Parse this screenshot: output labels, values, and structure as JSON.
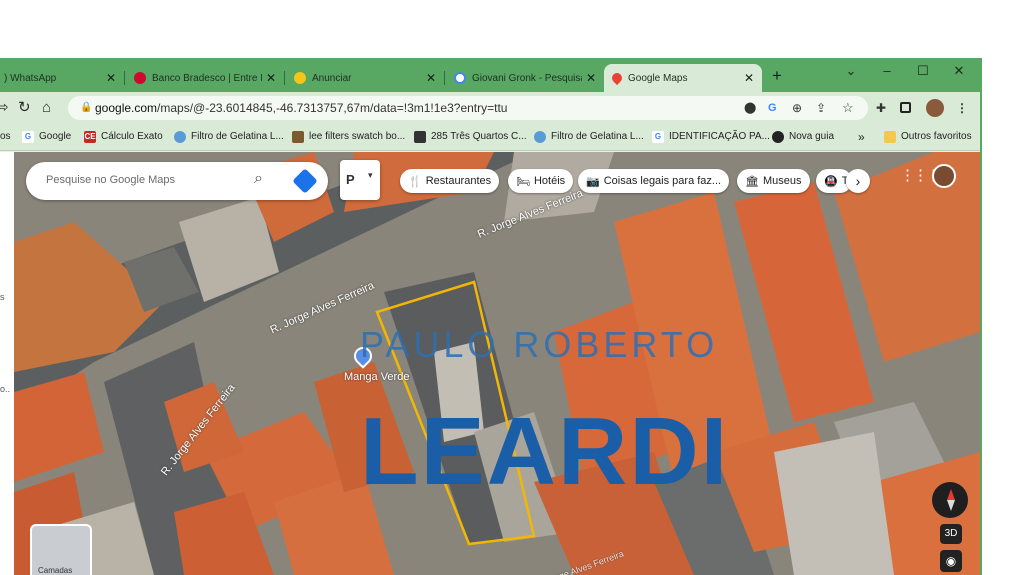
{
  "tabs": [
    {
      "label": ") WhatsApp",
      "icon": "whatsapp-icon"
    },
    {
      "label": "Banco Bradesco | Entre N",
      "icon": "bradesco-icon"
    },
    {
      "label": "Anunciar",
      "icon": "anunciar-icon"
    },
    {
      "label": "Giovani Gronk - Pesquisa",
      "icon": "google-icon"
    },
    {
      "label": "Google Maps",
      "icon": "maps-pin-icon",
      "active": true
    }
  ],
  "new_tab_symbol": "+",
  "window_controls": {
    "dropdown": "⌄",
    "minimize": "–",
    "maximize": "☐",
    "close": "✕"
  },
  "address_bar": {
    "domain": "google.com",
    "path": "/maps/@-23.6014845,-46.7313757,67m/data=!3m1!1e3?entry=ttu"
  },
  "bookmarks": [
    {
      "label": "os",
      "icon": "none"
    },
    {
      "label": "Google",
      "icon": "google-icon"
    },
    {
      "label": "Cálculo Exato",
      "icon": "ce-icon"
    },
    {
      "label": "Filtro de Gelatina L...",
      "icon": "globe-icon"
    },
    {
      "label": "lee filters swatch bo...",
      "icon": "bag-icon"
    },
    {
      "label": "285 Três Quartos C...",
      "icon": "doc-icon"
    },
    {
      "label": "Filtro de Gelatina L...",
      "icon": "globe-icon"
    },
    {
      "label": "IDENTIFICAÇÃO PA...",
      "icon": "google-icon"
    },
    {
      "label": "Nova guia",
      "icon": "chrome-icon"
    }
  ],
  "bookmarks_overflow": "»",
  "other_bookmarks": "Outros favoritos",
  "map": {
    "search_placeholder": "Pesquise no Google Maps",
    "layer_button": "P",
    "chips": [
      {
        "label": "Restaurantes",
        "icon": "🍴"
      },
      {
        "label": "Hotéis",
        "icon": "🛏"
      },
      {
        "label": "Coisas legais para faz...",
        "icon": "📷"
      },
      {
        "label": "Museus",
        "icon": "🏛"
      },
      {
        "label": "T",
        "icon": "🚇"
      }
    ],
    "chip_next": "›",
    "street_labels": [
      "R. Jorge Alves Ferreira",
      "R. Jorge Alves Ferreira",
      "R. Jorge Alves Ferreira",
      "R. Jorge Alves Ferreira"
    ],
    "place_label": "Manga Verde",
    "watermark_top": "PAULO ROBERTO",
    "watermark_bottom": "LEARDI",
    "control_3d": "3D",
    "zoom_in": "+",
    "zoom_out": "–",
    "layers_label": "Camadas"
  },
  "colors": {
    "frame_green": "#58a864",
    "toolbar_green": "#d9ebd6",
    "lot_outline": "#f2b705",
    "watermark_blue": "#1a5ea8"
  }
}
